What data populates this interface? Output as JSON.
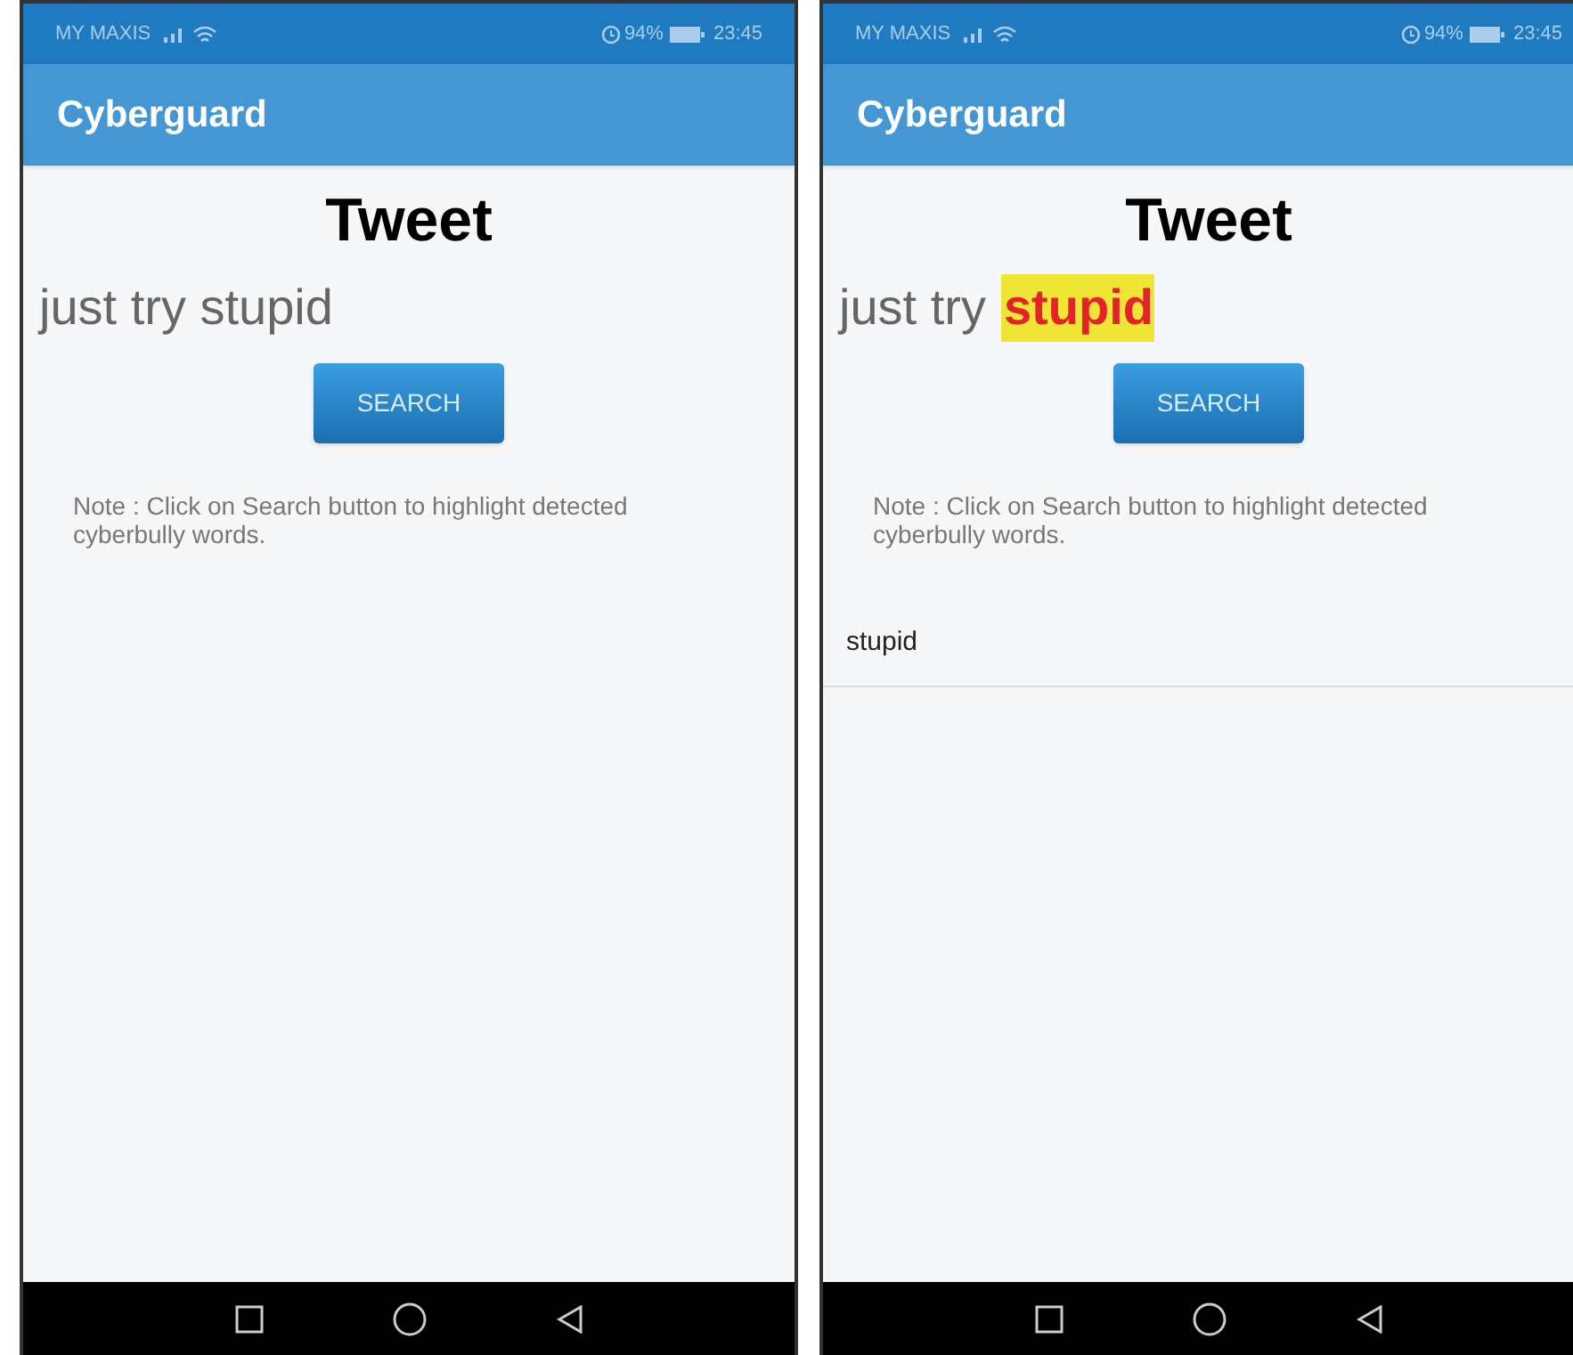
{
  "screens": [
    {
      "status_bar": {
        "carrier": "MY MAXIS",
        "battery": "94%",
        "time": "23:45"
      },
      "app_bar": {
        "title": "Cyberguard"
      },
      "heading": "Tweet",
      "tweet": [
        {
          "text": "just try stupid",
          "highlighted": false
        }
      ],
      "search_button": "SEARCH",
      "note": "Note : Click on Search button to highlight detected cyberbully words."
    },
    {
      "status_bar": {
        "carrier": "MY MAXIS",
        "battery": "94%",
        "time": "23:45"
      },
      "app_bar": {
        "title": "Cyberguard"
      },
      "heading": "Tweet",
      "tweet": [
        {
          "text": "just try",
          "highlighted": false
        },
        {
          "text": "stupid",
          "highlighted": true
        }
      ],
      "search_button": "SEARCH",
      "note": "Note : Click on Search button to highlight detected cyberbully words.",
      "results": [
        "stupid"
      ]
    }
  ]
}
